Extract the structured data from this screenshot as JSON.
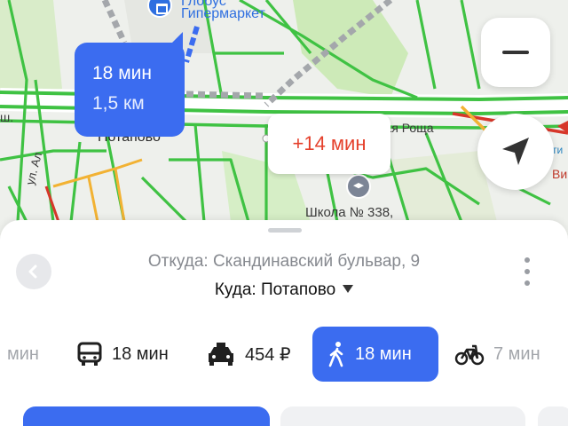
{
  "map": {
    "poi_store_line1": "Глобус",
    "poi_store_line2": "Гипермаркет",
    "label_potapovo": "Потапово",
    "label_rosha": "ская Роща",
    "label_school": "Школа № 338,",
    "label_sh": "ш.",
    "label_ul": "ул. Ал",
    "label_vi": "Ви",
    "label_vi2": "ти",
    "route_time": "18 мин",
    "route_distance": "1,5 км",
    "alt_route_delta": "+14 мин",
    "colors": {
      "route_blue": "#3b6cf0",
      "traffic_green": "#3fc243",
      "traffic_yellow": "#f2b233",
      "traffic_red": "#d7372a",
      "delta_red": "#e5402b"
    }
  },
  "controls": {
    "zoom_out_icon": "minus-icon",
    "locate_icon": "navigation-arrow-icon"
  },
  "sheet": {
    "from_text": "Откуда: Скандинавский бульвар, 9",
    "to_text": "Куда: Потапово",
    "modes": [
      {
        "id": "car",
        "icon": "car-icon",
        "label": "мин"
      },
      {
        "id": "transit",
        "icon": "bus-icon",
        "label": "18 мин"
      },
      {
        "id": "taxi",
        "icon": "taxi-icon",
        "label": "454 ₽"
      },
      {
        "id": "walk",
        "icon": "pedestrian-icon",
        "label": "18 мин",
        "selected": true
      },
      {
        "id": "bike",
        "icon": "bicycle-icon",
        "label": "7 мин"
      }
    ]
  }
}
